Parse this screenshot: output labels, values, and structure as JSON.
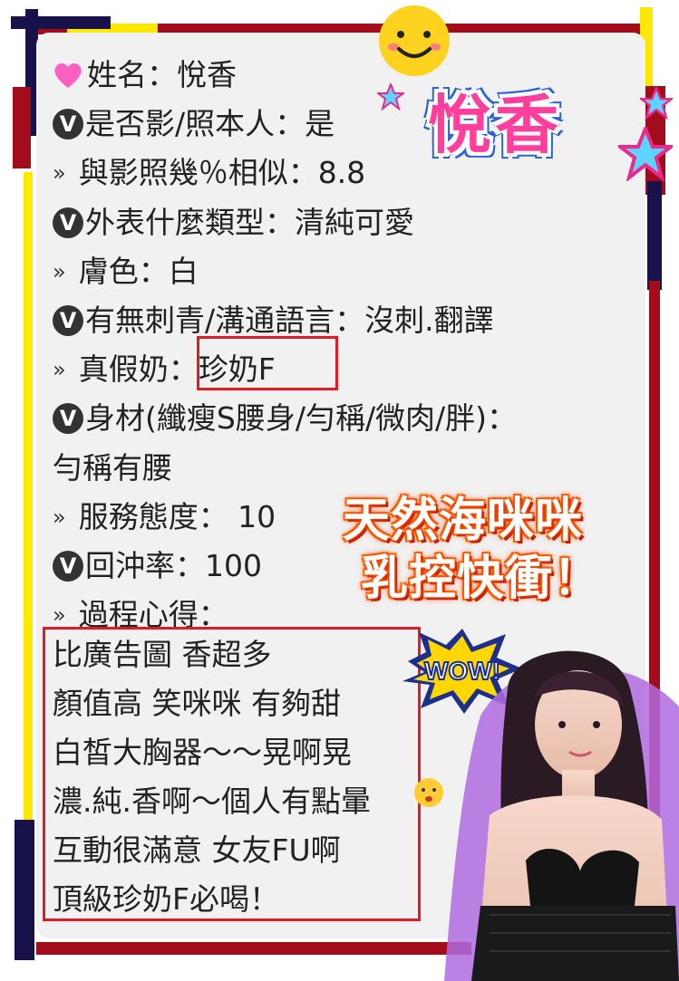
{
  "profile": {
    "title": "悅香",
    "lines": [
      {
        "bullet": "heart",
        "text": "姓名：悅香"
      },
      {
        "bullet": "v",
        "text": "是否影/照本人：是"
      },
      {
        "bullet": "arrow",
        "text": "與影照幾％相似：8.8"
      },
      {
        "bullet": "v",
        "text": "外表什麼類型：清純可愛"
      },
      {
        "bullet": "arrow",
        "text": "膚色：白"
      },
      {
        "bullet": "v",
        "text": "有無刺青/溝通語言：沒刺.翻譯"
      },
      {
        "bullet": "arrow",
        "text": "真假奶：珍奶F"
      },
      {
        "bullet": "v",
        "text": "身材(纖瘦S腰身/勻稱/微肉/胖)："
      },
      {
        "bullet": "none",
        "text": "勻稱有腰"
      },
      {
        "bullet": "arrow",
        "text": "服務態度： 10"
      },
      {
        "bullet": "v",
        "text": "回沖率：100"
      },
      {
        "bullet": "arrow",
        "text": "過程心得："
      }
    ],
    "review": [
      "比廣告圖 香超多",
      "顏值高 笑咪咪 有夠甜",
      "白皙大胸器～～晃啊晃",
      "濃.純.香啊～個人有點暈",
      "互動很滿意 女友FU啊",
      "頂級珍奶F必喝！"
    ]
  },
  "promo": {
    "line1": "天然海咪咪",
    "line2": "乳控快衝！"
  },
  "stickers": {
    "wow": "WOW!",
    "smiley_icon": "smiley-icon",
    "star_icon": "star-icon"
  },
  "colors": {
    "dark_red": "#a30c1a",
    "navy": "#17124a",
    "yellow": "#ffe800",
    "box_red": "#e21a24",
    "title_pink": "#ff3f9b"
  }
}
